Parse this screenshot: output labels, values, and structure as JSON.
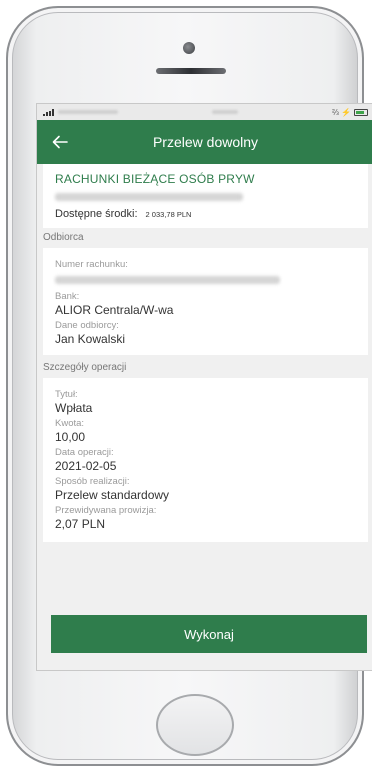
{
  "status_bar": {
    "battery_text": "⅔ ⚡"
  },
  "app_bar": {
    "title": "Przelew dowolny",
    "back_icon": "arrow-left-icon"
  },
  "account": {
    "name": "RACHUNKI BIEŻĄCE OSÓB PRYW",
    "available_label": "Dostępne środki:",
    "available_value": "2 033,78 PLN"
  },
  "recipient_section": {
    "header": "Odbiorca",
    "account_number_label": "Numer rachunku:",
    "bank_label": "Bank:",
    "bank_value": "ALIOR Centrala/W-wa",
    "recipient_data_label": "Dane odbiorcy:",
    "recipient_data_value": "Jan Kowalski"
  },
  "operation_section": {
    "header": "Szczegóły operacji",
    "title_label": "Tytuł:",
    "title_value": "Wpłata",
    "amount_label": "Kwota:",
    "amount_value": "10,00",
    "date_label": "Data operacji:",
    "date_value": "2021-02-05",
    "method_label": "Sposób realizacji:",
    "method_value": "Przelew standardowy",
    "fee_label": "Przewidywana prowizja:",
    "fee_value": "2,07 PLN"
  },
  "action": {
    "execute_label": "Wykonaj"
  },
  "colors": {
    "brand_green": "#2f7d4c",
    "background": "#f0f0f0"
  }
}
